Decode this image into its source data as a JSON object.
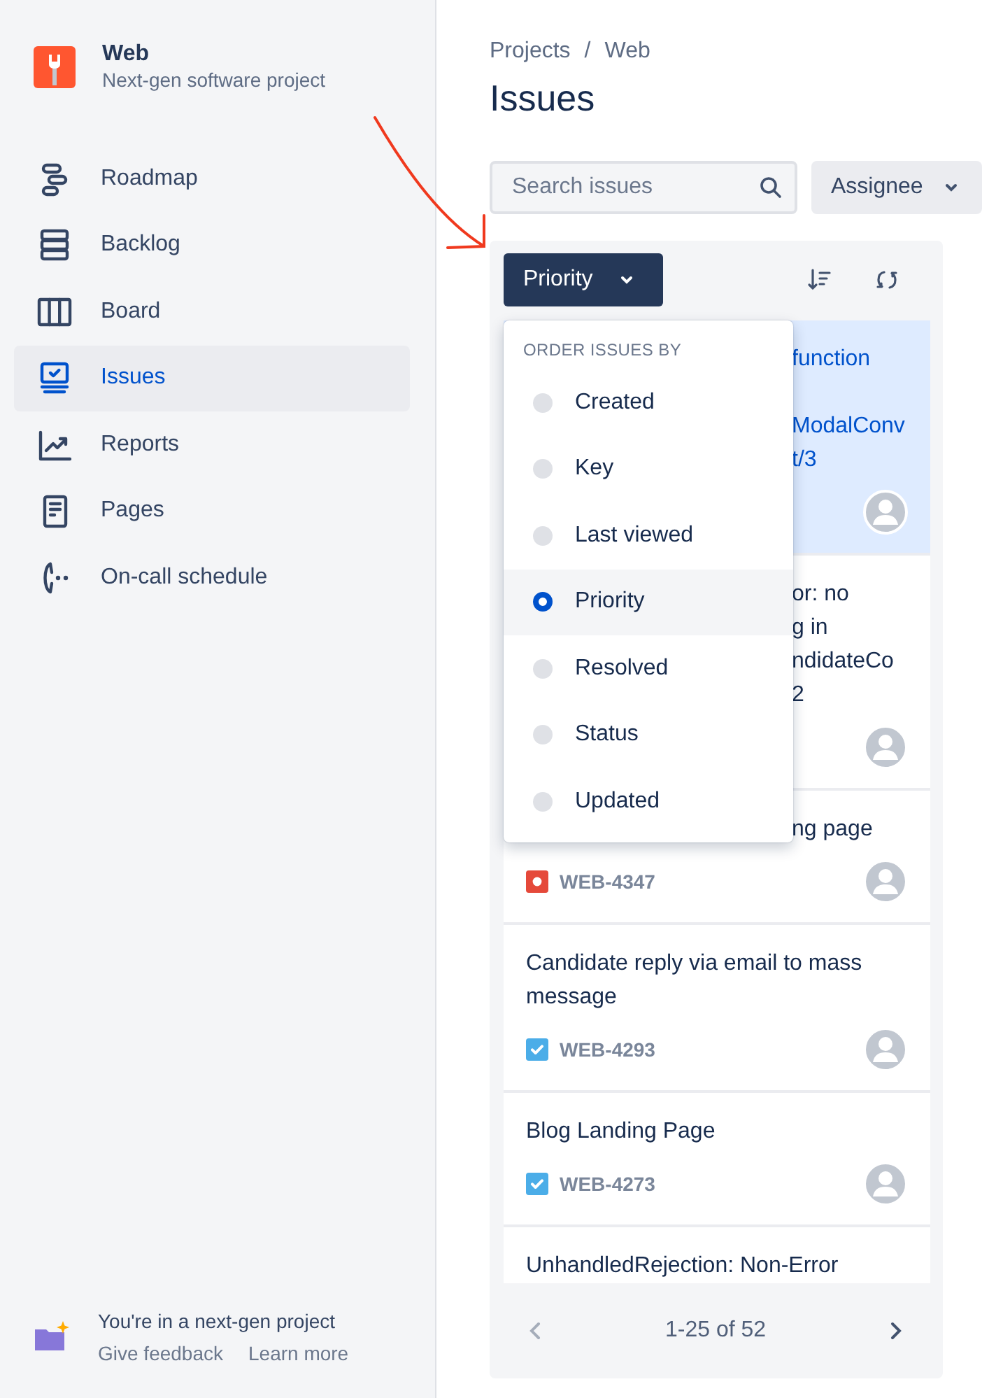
{
  "sidebar": {
    "project": {
      "name": "Web",
      "subtitle": "Next-gen software project"
    },
    "items": [
      {
        "label": "Roadmap",
        "kind": "roadmap",
        "selected": false
      },
      {
        "label": "Backlog",
        "kind": "backlog",
        "selected": false
      },
      {
        "label": "Board",
        "kind": "board",
        "selected": false
      },
      {
        "label": "Issues",
        "kind": "issues",
        "selected": true
      },
      {
        "label": "Reports",
        "kind": "reports",
        "selected": false
      },
      {
        "label": "Pages",
        "kind": "pages",
        "selected": false
      },
      {
        "label": "On-call schedule",
        "kind": "oncall",
        "selected": false
      }
    ],
    "footer": {
      "message": "You're in a next-gen project",
      "links": [
        "Give feedback",
        "Learn more"
      ]
    }
  },
  "breadcrumbs": {
    "items": [
      "Projects",
      "Web"
    ],
    "separator": "/"
  },
  "title": "Issues",
  "search": {
    "placeholder": "Search issues"
  },
  "filters": [
    {
      "label": "Assignee"
    }
  ],
  "sort_button": {
    "label": "Priority"
  },
  "order_menu": {
    "heading": "ORDER ISSUES BY",
    "options": [
      {
        "label": "Created",
        "selected": false
      },
      {
        "label": "Key",
        "selected": false
      },
      {
        "label": "Last viewed",
        "selected": false
      },
      {
        "label": "Priority",
        "selected": true
      },
      {
        "label": "Resolved",
        "selected": false
      },
      {
        "label": "Status",
        "selected": false
      },
      {
        "label": "Updated",
        "selected": false
      }
    ]
  },
  "issues": [
    {
      "selected": true,
      "title_fragments": [
        [
          "function"
        ],
        [
          "ModalConv",
          "t/3"
        ]
      ]
    },
    {
      "selected": false,
      "title_fragments": [
        [
          "or: no",
          "g in",
          "ndidateCo",
          "2"
        ]
      ]
    },
    {
      "selected": false,
      "title_fragments": [
        [
          "ng page"
        ]
      ],
      "kind": "bug",
      "key": "WEB-4347"
    },
    {
      "selected": false,
      "title": "Candidate reply via email to mass message",
      "kind": "task",
      "key": "WEB-4293"
    },
    {
      "selected": false,
      "title": "Blog Landing Page",
      "kind": "task",
      "key": "WEB-4273"
    },
    {
      "selected": false,
      "title": "UnhandledRejection: Non-Error"
    }
  ],
  "pagination": {
    "range": "1-25 of 52",
    "previous_disabled": true,
    "next_disabled": false
  }
}
